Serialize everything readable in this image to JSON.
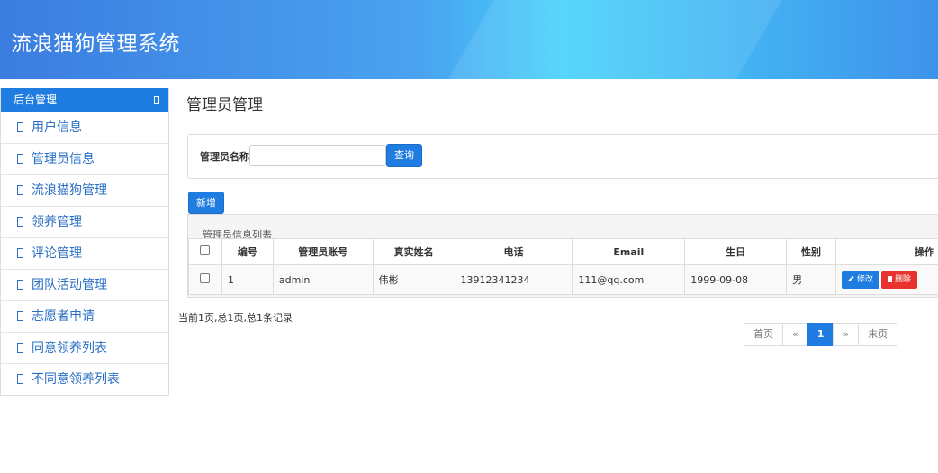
{
  "header": {
    "title": "流浪猫狗管理系统"
  },
  "sidebar": {
    "heading": "后台管理",
    "items": [
      {
        "label": "用户信息"
      },
      {
        "label": "管理员信息"
      },
      {
        "label": "流浪猫狗管理"
      },
      {
        "label": "领养管理"
      },
      {
        "label": "评论管理"
      },
      {
        "label": "团队活动管理"
      },
      {
        "label": "志愿者申请"
      },
      {
        "label": "同意领养列表"
      },
      {
        "label": "不同意领养列表"
      }
    ]
  },
  "main": {
    "title": "管理员管理",
    "search": {
      "label": "管理员名称",
      "value": "",
      "placeholder": "",
      "button": "查询"
    },
    "add_button": "新增",
    "table": {
      "caption": "管理员信息列表",
      "columns": [
        "编号",
        "管理员账号",
        "真实姓名",
        "电话",
        "Email",
        "生日",
        "性别",
        "操作"
      ],
      "rows": [
        {
          "id": "1",
          "account": "admin",
          "name": "伟彬",
          "phone": "13912341234",
          "email": "111@qq.com",
          "birthday": "1999-09-08",
          "gender": "男",
          "edit_label": "修改",
          "delete_label": "删除"
        }
      ]
    },
    "record_info": "当前1页,总1页,总1条记录",
    "pagination": {
      "first": "首页",
      "prev": "«",
      "current": "1",
      "next": "»",
      "last": "末页"
    }
  },
  "colors": {
    "primary": "#1f7ce0",
    "danger": "#e8322e",
    "header_gradient_light": "#45d2fb"
  }
}
